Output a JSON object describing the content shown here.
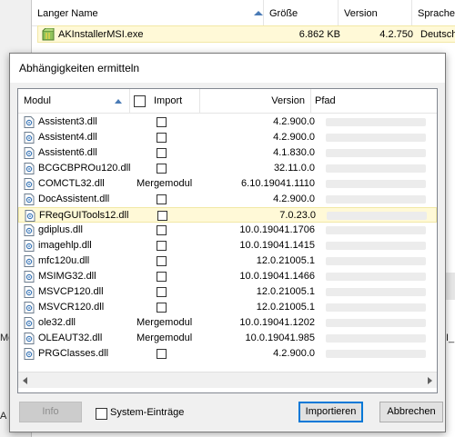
{
  "background": {
    "columns": [
      "Langer Name",
      "Größe",
      "Version",
      "Sprache"
    ],
    "row": {
      "name": "AKInstallerMSI.exe",
      "size": "6.862 KB",
      "version": "4.2.750",
      "language": "Deutsch"
    },
    "left_fragments": [
      "Mei",
      "A"
    ],
    "right_fragment": "I_"
  },
  "dialog": {
    "title": "Abhängigkeiten ermitteln",
    "columns": {
      "module": "Modul",
      "import": "Import",
      "version": "Version",
      "path": "Pfad"
    },
    "rows": [
      {
        "module": "Assistent3.dll",
        "import": "checkbox",
        "import_text": "",
        "version": "4.2.900.0"
      },
      {
        "module": "Assistent4.dll",
        "import": "checkbox",
        "import_text": "",
        "version": "4.2.900.0"
      },
      {
        "module": "Assistent6.dll",
        "import": "checkbox",
        "import_text": "",
        "version": "4.1.830.0"
      },
      {
        "module": "BCGCBPROu120.dll",
        "import": "checkbox",
        "import_text": "",
        "version": "32.11.0.0"
      },
      {
        "module": "COMCTL32.dll",
        "import": "text",
        "import_text": "Mergemodul",
        "version": "6.10.19041.1110"
      },
      {
        "module": "DocAssistent.dll",
        "import": "checkbox",
        "import_text": "",
        "version": "4.2.900.0"
      },
      {
        "module": "FReqGUITools12.dll",
        "import": "checkbox",
        "import_text": "",
        "version": "7.0.23.0",
        "selected": true
      },
      {
        "module": "gdiplus.dll",
        "import": "checkbox",
        "import_text": "",
        "version": "10.0.19041.1706"
      },
      {
        "module": "imagehlp.dll",
        "import": "checkbox",
        "import_text": "",
        "version": "10.0.19041.1415"
      },
      {
        "module": "mfc120u.dll",
        "import": "checkbox",
        "import_text": "",
        "version": "12.0.21005.1"
      },
      {
        "module": "MSIMG32.dll",
        "import": "checkbox",
        "import_text": "",
        "version": "10.0.19041.1466"
      },
      {
        "module": "MSVCP120.dll",
        "import": "checkbox",
        "import_text": "",
        "version": "12.0.21005.1"
      },
      {
        "module": "MSVCR120.dll",
        "import": "checkbox",
        "import_text": "",
        "version": "12.0.21005.1"
      },
      {
        "module": "ole32.dll",
        "import": "text",
        "import_text": "Mergemodul",
        "version": "10.0.19041.1202"
      },
      {
        "module": "OLEAUT32.dll",
        "import": "text",
        "import_text": "Mergemodul",
        "version": "10.0.19041.985"
      },
      {
        "module": "PRGClasses.dll",
        "import": "checkbox",
        "import_text": "",
        "version": "4.2.900.0"
      }
    ],
    "buttons": {
      "info": "Info",
      "import": "Importieren",
      "cancel": "Abbrechen"
    },
    "system_entries_label": "System-Einträge"
  },
  "colors": {
    "selection": "#fff9d7",
    "accent": "#0078d7",
    "dialog_bg": "#f0f0f0"
  }
}
